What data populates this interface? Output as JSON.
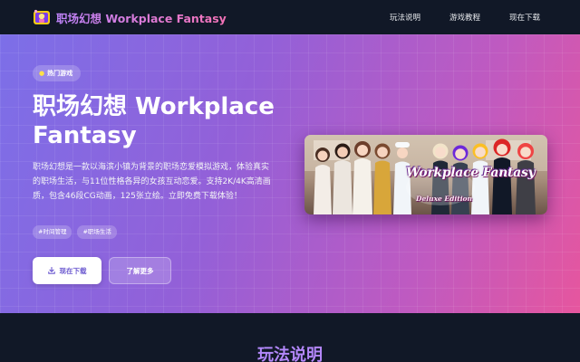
{
  "brand": {
    "title": "职场幻想 Workplace Fantasy",
    "logo_icon": "game-character-logo-icon"
  },
  "nav": {
    "items": [
      {
        "label": "玩法说明"
      },
      {
        "label": "游戏教程"
      },
      {
        "label": "现在下载"
      }
    ]
  },
  "hero": {
    "badge": {
      "icon": "lightbulb-icon",
      "label": "热门游戏"
    },
    "title": "职场幻想 Workplace Fantasy",
    "description": "职场幻想是一款以海滨小镇为背景的职场恋爱模拟游戏，体验真实的职场生活，与11位性格各异的女孩互动恋爱。支持2K/4K高清画质，包含46段CG动画，125张立绘。立即免费下载体验！",
    "tags": [
      "#时间管理",
      "#职场生活"
    ],
    "primary_button": {
      "icon": "download-icon",
      "label": "现在下载"
    },
    "secondary_button": {
      "label": "了解更多"
    }
  },
  "game_art": {
    "logo_main": "Workplace Fantasy",
    "logo_sub": "Deluxe Edition"
  },
  "next_section": {
    "title": "玩法说明"
  },
  "colors": {
    "page_bg": "#111827",
    "hero_gradient_start": "#7c6fe8",
    "hero_gradient_end": "#e6569e",
    "brand_gradient_start": "#c084fc",
    "brand_gradient_end": "#f472b6",
    "primary_button_text": "#6d5bd0"
  }
}
